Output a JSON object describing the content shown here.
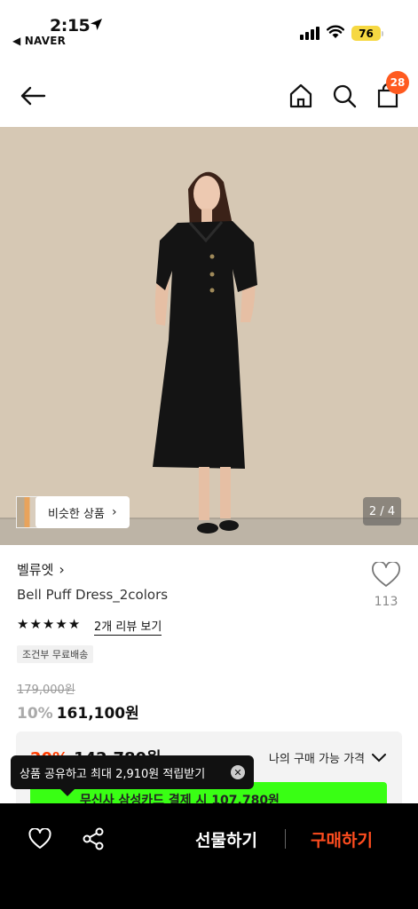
{
  "status_bar": {
    "time": "2:15",
    "back_app": "◀ NAVER",
    "battery": "76",
    "battery_color": "#f6d842",
    "icons": [
      "location-arrow-icon",
      "cellular-signal-icon",
      "wifi-icon",
      "battery-icon"
    ]
  },
  "nav": {
    "icons": [
      "back-arrow-icon",
      "home-icon",
      "search-icon",
      "shopping-bag-icon"
    ],
    "cart_badge": "28",
    "badge_color": "#ff5a1f"
  },
  "gallery": {
    "similar_label": "비슷한 상품",
    "page_indicator": "2 / 4"
  },
  "product": {
    "brand": "벨류엣",
    "name": "Bell Puff Dress_2colors",
    "like_count": "113",
    "rating_stars": 5,
    "review_link": "2개 리뷰 보기",
    "shipping_tag": "조건부 무료배송",
    "original_price": "179,000원",
    "discount_percent": "10%",
    "sale_price": "161,100원"
  },
  "best_price": {
    "percent": "20%",
    "price": "142,780원",
    "my_price_label": "나의 구매 가능 가격",
    "card_offer": "무신사 삼성카드 결제 시 107,780원",
    "accent_color": "#ff3d00",
    "offer_bg": "#39ff14"
  },
  "tooltip": {
    "text": "상품 공유하고 최대 2,910원 적립받기"
  },
  "bottom_bar": {
    "gift_label": "선물하기",
    "buy_label": "구매하기",
    "buy_color": "#ff4d1f",
    "icons": [
      "heart-icon",
      "share-icon"
    ]
  }
}
